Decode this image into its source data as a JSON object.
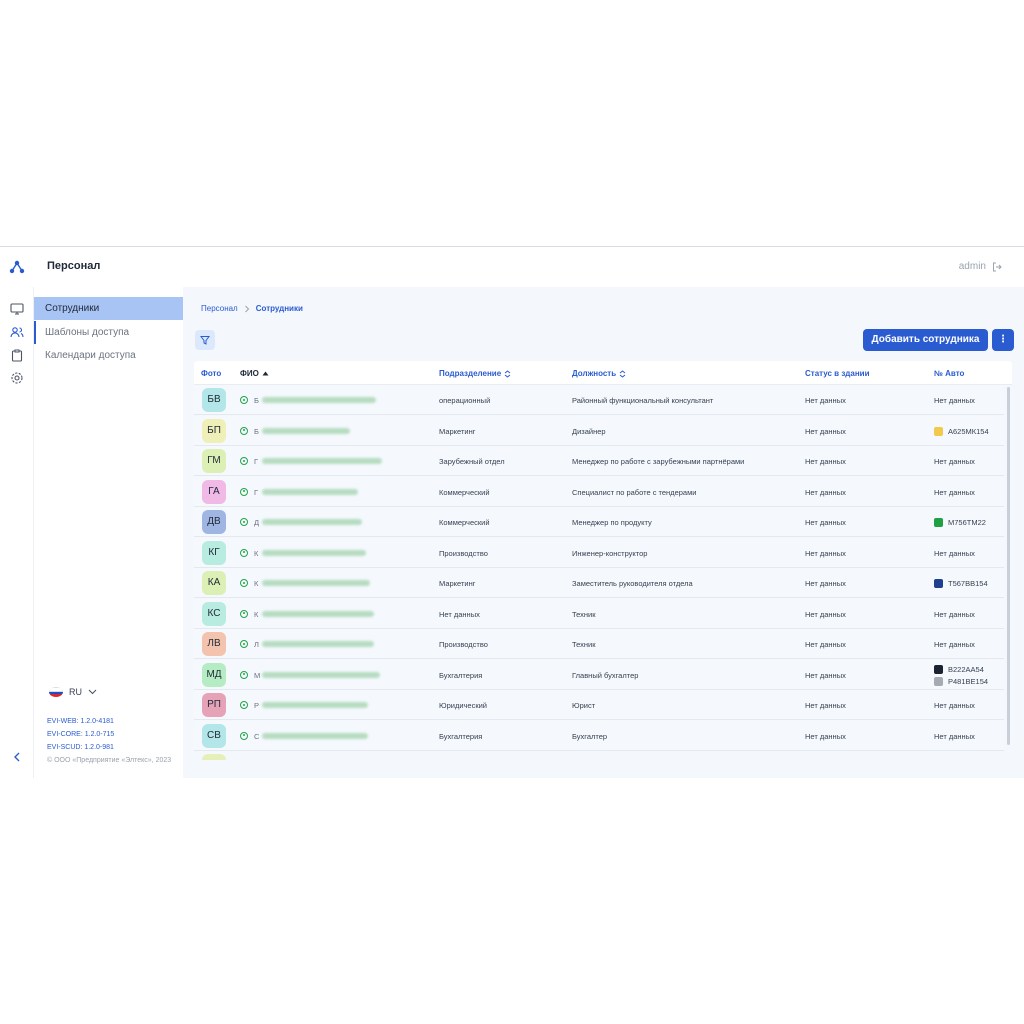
{
  "header": {
    "title": "Персонал",
    "user": "admin"
  },
  "nav": {
    "items": [
      {
        "label": "Сотрудники"
      },
      {
        "label": "Шаблоны доступа"
      },
      {
        "label": "Календари доступа"
      }
    ]
  },
  "footer": {
    "lang": "RU",
    "versions": [
      "EVI-WEB: 1.2.0-4181",
      "EVI-CORE: 1.2.0-715",
      "EVI-SCUD: 1.2.0-981"
    ],
    "copyright": "© ООО «Предприятие «Элтекс», 2023"
  },
  "breadcrumb": {
    "root": "Персонал",
    "current": "Сотрудники"
  },
  "toolbar": {
    "add_label": "Добавить сотрудника",
    "more_label": "⋮"
  },
  "table": {
    "columns": [
      "Фото",
      "ФИО",
      "Подразделение",
      "Должность",
      "Статус в здании",
      "№ Авто"
    ],
    "rows": [
      {
        "initials": "БВ",
        "avatar": "#b3e6e8",
        "name_initial": "Б",
        "dept": "операционный",
        "position": "Районный функциональный консультант",
        "status": "Нет данных",
        "plates": [
          {
            "text": "Нет данных",
            "color": ""
          }
        ]
      },
      {
        "initials": "БП",
        "avatar": "#eef0b8",
        "name_initial": "Б",
        "dept": "Маркетинг",
        "position": "Дизайнер",
        "status": "Нет данных",
        "plates": [
          {
            "text": "А625МК154",
            "color": "#f2c94c"
          }
        ]
      },
      {
        "initials": "ГМ",
        "avatar": "#dcefb5",
        "name_initial": "Г",
        "dept": "Зарубежный отдел",
        "position": "Менеджер по работе с зарубежными партнёрами",
        "status": "Нет данных",
        "plates": [
          {
            "text": "Нет данных",
            "color": ""
          }
        ]
      },
      {
        "initials": "ГА",
        "avatar": "#f0b9e6",
        "name_initial": "Г",
        "dept": "Коммерческий",
        "position": "Специалист по работе с тендерами",
        "status": "Нет данных",
        "plates": [
          {
            "text": "Нет данных",
            "color": ""
          }
        ]
      },
      {
        "initials": "ДВ",
        "avatar": "#9fb6e3",
        "name_initial": "Д",
        "dept": "Коммерческий",
        "position": "Менеджер по продукту",
        "status": "Нет данных",
        "plates": [
          {
            "text": "М756ТМ22",
            "color": "#1ea043"
          }
        ]
      },
      {
        "initials": "КГ",
        "avatar": "#b8ece0",
        "name_initial": "К",
        "dept": "Производство",
        "position": "Инженер-конструктор",
        "status": "Нет данных",
        "plates": [
          {
            "text": "Нет данных",
            "color": ""
          }
        ]
      },
      {
        "initials": "КА",
        "avatar": "#dcefb5",
        "name_initial": "К",
        "dept": "Маркетинг",
        "position": "Заместитель руководителя отдела",
        "status": "Нет данных",
        "plates": [
          {
            "text": "Т567ВВ154",
            "color": "#1f3f8f"
          }
        ]
      },
      {
        "initials": "КС",
        "avatar": "#b8ece0",
        "name_initial": "К",
        "dept": "Нет данных",
        "position": "Техник",
        "status": "Нет данных",
        "plates": [
          {
            "text": "Нет данных",
            "color": ""
          }
        ]
      },
      {
        "initials": "ЛВ",
        "avatar": "#f4c3ae",
        "name_initial": "Л",
        "dept": "Производство",
        "position": "Техник",
        "status": "Нет данных",
        "plates": [
          {
            "text": "Нет данных",
            "color": ""
          }
        ]
      },
      {
        "initials": "МД",
        "avatar": "#b5ecc4",
        "name_initial": "М",
        "dept": "Бухгалтерия",
        "position": "Главный бухгалтер",
        "status": "Нет данных",
        "plates": [
          {
            "text": "В222АА54",
            "color": "#1b2333"
          },
          {
            "text": "Р481ВЕ154",
            "color": "#a6abb3"
          }
        ]
      },
      {
        "initials": "РП",
        "avatar": "#e6a3b8",
        "name_initial": "Р",
        "dept": "Юридический",
        "position": "Юрист",
        "status": "Нет данных",
        "plates": [
          {
            "text": "Нет данных",
            "color": ""
          }
        ]
      },
      {
        "initials": "СВ",
        "avatar": "#b3e6e8",
        "name_initial": "С",
        "dept": "Бухгалтерия",
        "position": "Бухгалтер",
        "status": "Нет данных",
        "plates": [
          {
            "text": "Нет данных",
            "color": ""
          }
        ]
      }
    ]
  },
  "colors": {
    "accent": "#2a5bd0",
    "status_green": "#22a447"
  }
}
